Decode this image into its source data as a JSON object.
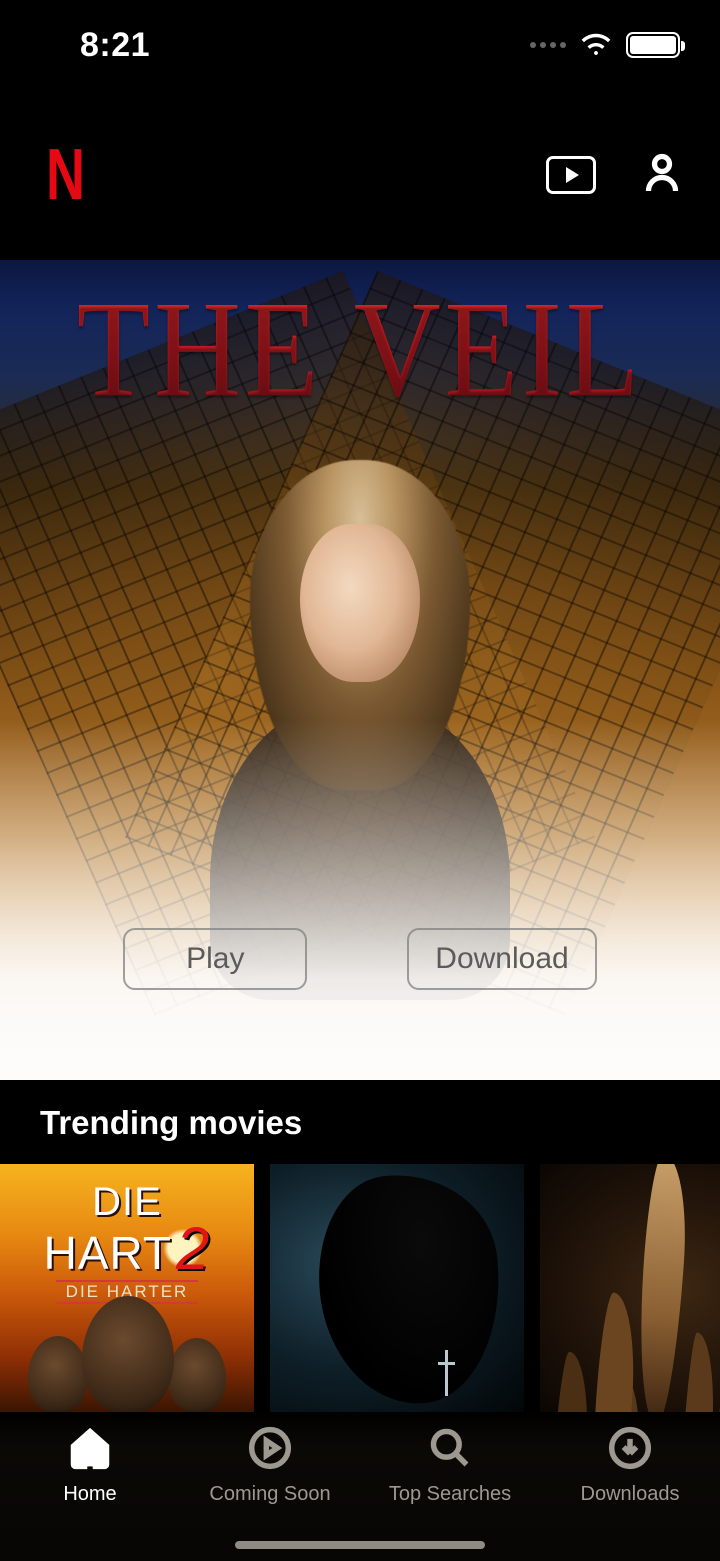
{
  "status": {
    "time": "8:21"
  },
  "hero": {
    "title": "THE VEIL",
    "play_label": "Play",
    "download_label": "Download"
  },
  "sections": {
    "trending": {
      "title": "Trending movies",
      "items": [
        {
          "title_line1": "DIE",
          "title_line2": "HART",
          "title_number": "2",
          "subtitle": "DIE HARTER"
        },
        {
          "title": ""
        },
        {
          "title": ""
        }
      ]
    }
  },
  "nav": {
    "home": "Home",
    "coming_soon": "Coming Soon",
    "top_searches": "Top Searches",
    "downloads": "Downloads",
    "active": "home"
  }
}
